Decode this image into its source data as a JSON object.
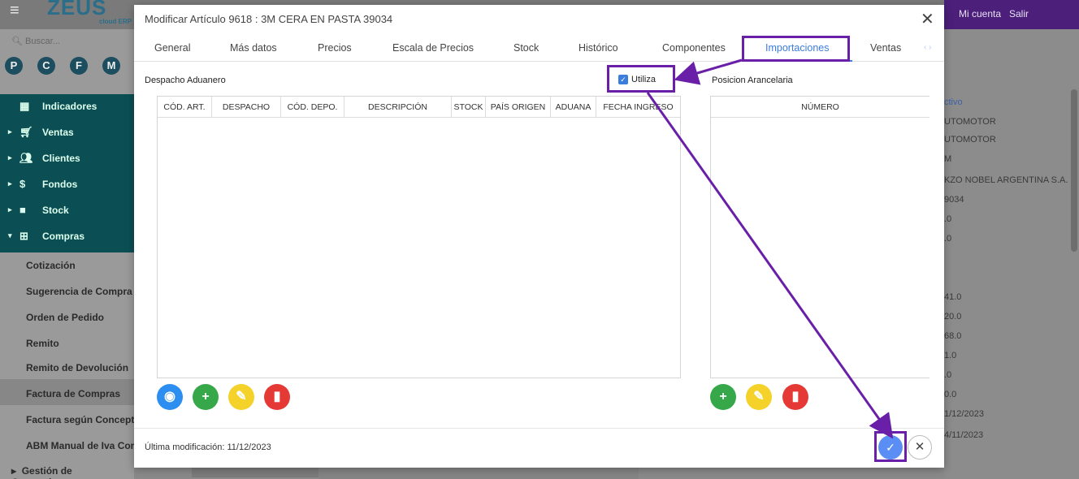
{
  "app": {
    "logo": "ZEUS",
    "logo_sub": "cloud ERP",
    "account": "Mi cuenta",
    "logout": "Salir",
    "search_placeholder": "Buscar...",
    "quick_buttons": [
      "P",
      "C",
      "F",
      "M"
    ]
  },
  "sidebar": {
    "nav": [
      {
        "label": "Indicadores",
        "icon": "chart-icon"
      },
      {
        "label": "Ventas",
        "icon": "cart-icon"
      },
      {
        "label": "Clientes",
        "icon": "people-icon"
      },
      {
        "label": "Fondos",
        "icon": "dollar-icon"
      },
      {
        "label": "Stock",
        "icon": "box-icon"
      },
      {
        "label": "Compras",
        "icon": "basket-icon"
      }
    ],
    "compras_items": [
      "Cotización",
      "Sugerencia de Compra",
      "Orden de Pedido",
      "Remito",
      "Remito de Devolución",
      "Factura de Compras",
      "Factura según Concepto",
      "ABM Manual de Iva Com"
    ],
    "gestion": "Gestión de Comprobantes"
  },
  "right_panel": {
    "lines": [
      "ctivo",
      "UTOMOTOR",
      "UTOMOTOR",
      "M",
      "KZO NOBEL ARGENTINA S.A.",
      "9034",
      ".0",
      ".0",
      "41.0",
      "20.0",
      "68.0",
      "1.0",
      ".0",
      "0.0",
      "1/12/2023",
      "4/11/2023"
    ]
  },
  "modal": {
    "title": "Modificar Artículo 9618 : 3M CERA EN PASTA 39034",
    "tabs": [
      "General",
      "Más datos",
      "Precios",
      "Escala de Precios",
      "Stock",
      "Histórico",
      "Componentes",
      "Importaciones",
      "Ventas"
    ],
    "active_tab": "Importaciones",
    "despacho_label": "Despacho Aduanero",
    "utiliza_label": "Utiliza",
    "utiliza_checked": true,
    "posicion_label": "Posicion Arancelaria",
    "despacho_columns": [
      "CÓD. ART.",
      "DESPACHO",
      "CÓD. DEPO.",
      "DESCRIPCIÓN",
      "STOCK",
      "PAÍS ORIGEN",
      "ADUANA",
      "FECHA INGRESO"
    ],
    "posicion_columns": [
      "NÚMERO"
    ],
    "footer_text": "Última modificación: 11/12/2023"
  },
  "colors": {
    "accent": "#3b7ddd",
    "annotation": "#6a1fa8",
    "teal_nav": "#0b4f54",
    "top_purple": "#4b1f7a"
  }
}
